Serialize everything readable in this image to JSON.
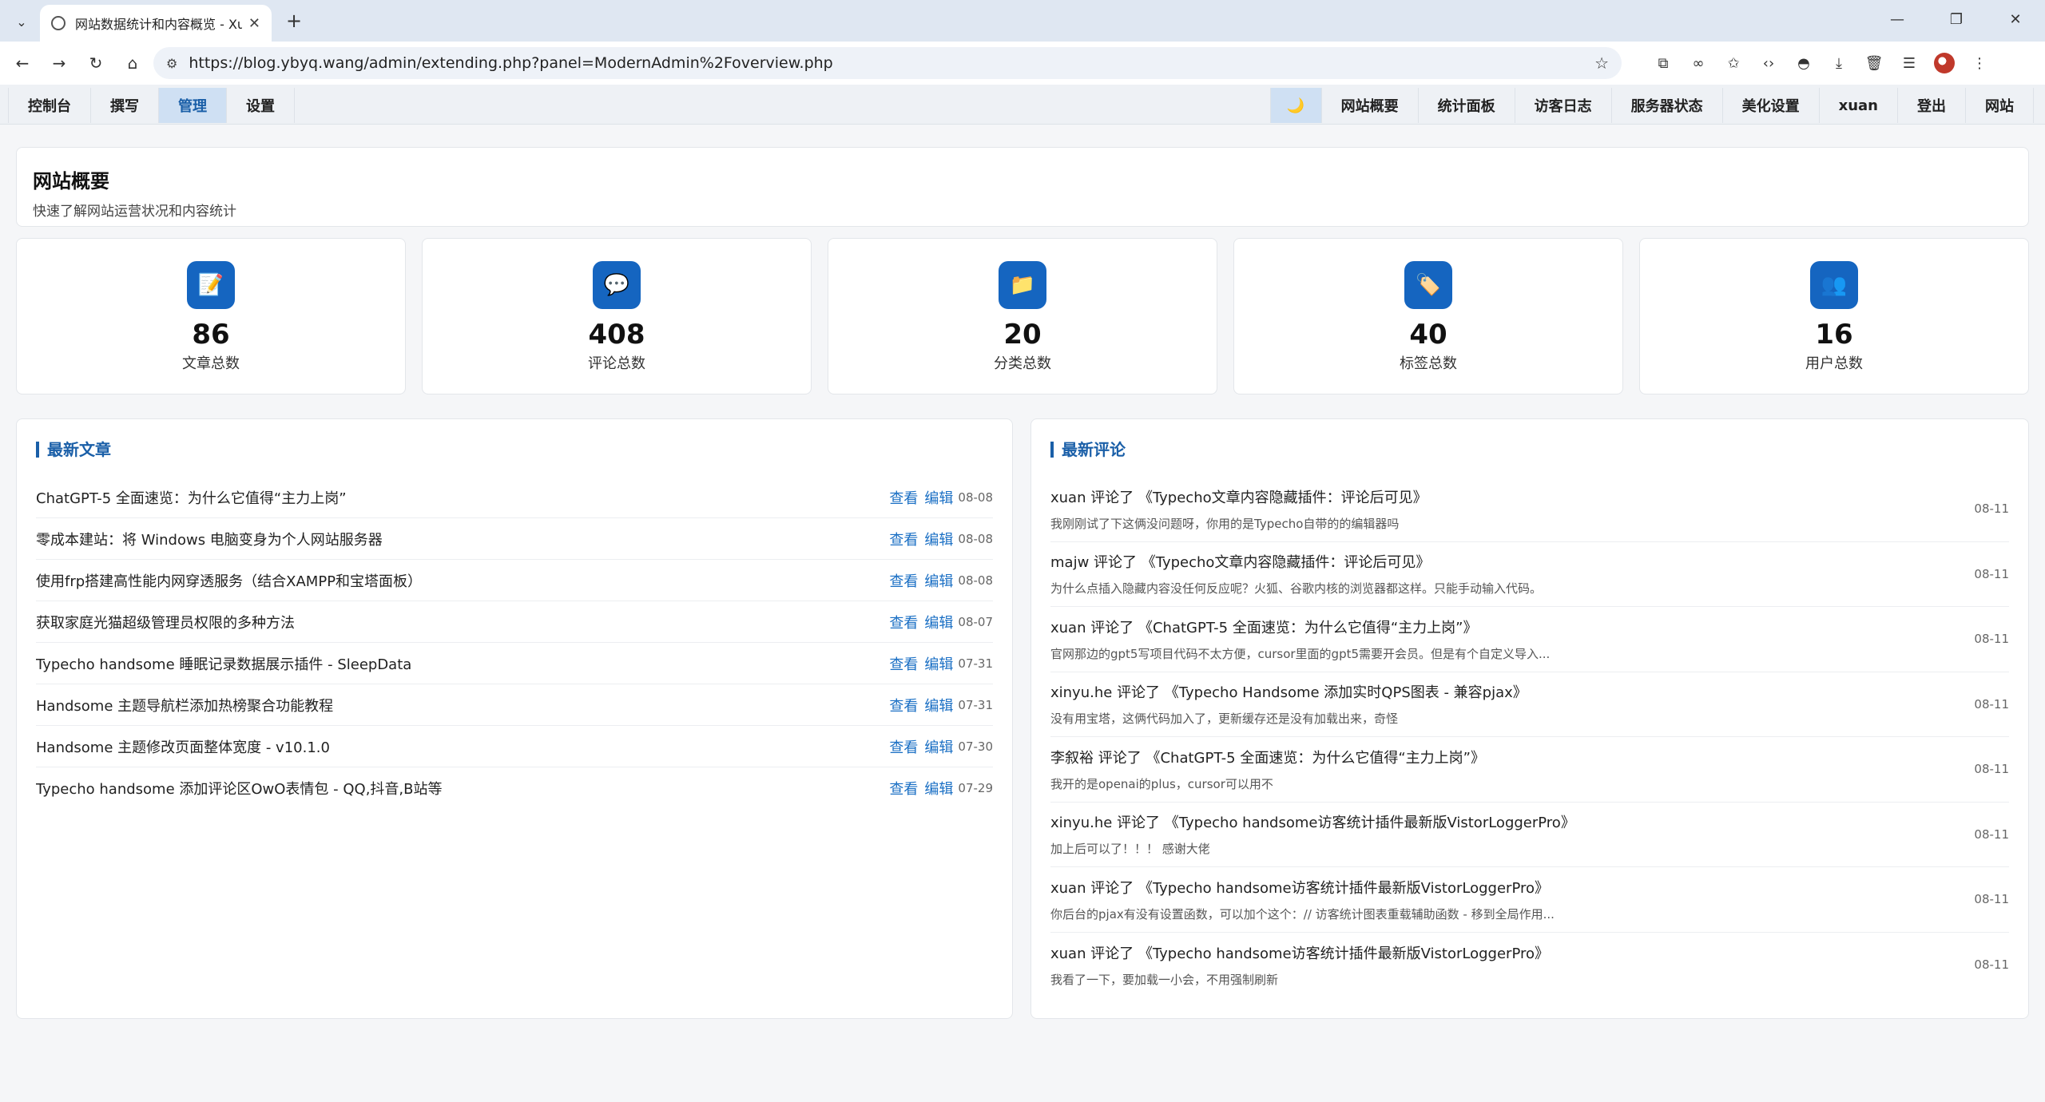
{
  "browser": {
    "tab_title": "网站数据统计和内容概览 - Xuan",
    "url": "https://blog.ybyq.wang/admin/extending.php?panel=ModernAdmin%2Foverview.php"
  },
  "nav": {
    "left": [
      "控制台",
      "撰写",
      "管理",
      "设置"
    ],
    "theme_icon": "🌙",
    "right": [
      "网站概要",
      "统计面板",
      "访客日志",
      "服务器状态",
      "美化设置",
      "xuan",
      "登出",
      "网站"
    ]
  },
  "header": {
    "title": "网站概要",
    "subtitle": "快速了解网站运营状况和内容统计"
  },
  "stats": [
    {
      "value": "86",
      "label": "文章总数",
      "icon": "📝"
    },
    {
      "value": "408",
      "label": "评论总数",
      "icon": "💬"
    },
    {
      "value": "20",
      "label": "分类总数",
      "icon": "📁"
    },
    {
      "value": "40",
      "label": "标签总数",
      "icon": "🏷️"
    },
    {
      "value": "16",
      "label": "用户总数",
      "icon": "👥"
    }
  ],
  "recent_posts": {
    "title": "最新文章",
    "view_label": "查看",
    "edit_label": "编辑",
    "items": [
      {
        "title": "ChatGPT-5 全面速览：为什么它值得“主力上岗”",
        "date": "08-08"
      },
      {
        "title": "零成本建站：将 Windows 电脑变身为个人网站服务器",
        "date": "08-08"
      },
      {
        "title": "使用frp搭建高性能内网穿透服务（结合XAMPP和宝塔面板）",
        "date": "08-08"
      },
      {
        "title": "获取家庭光猫超级管理员权限的多种方法",
        "date": "08-07"
      },
      {
        "title": "Typecho handsome 睡眠记录数据展示插件 - SleepData",
        "date": "07-31"
      },
      {
        "title": "Handsome 主题导航栏添加热榜聚合功能教程",
        "date": "07-31"
      },
      {
        "title": "Handsome 主题修改页面整体宽度 - v10.1.0",
        "date": "07-30"
      },
      {
        "title": "Typecho handsome 添加评论区OwO表情包 - QQ,抖音,B站等",
        "date": "07-29"
      }
    ]
  },
  "recent_comments": {
    "title": "最新评论",
    "items": [
      {
        "author": "xuan",
        "verb": "评论了",
        "post": "《Typecho文章内容隐藏插件：评论后可见》",
        "excerpt": "我刚刚试了下这俩没问题呀，你用的是Typecho自带的的编辑器吗",
        "date": "08-11"
      },
      {
        "author": "majw",
        "verb": "评论了",
        "post": "《Typecho文章内容隐藏插件：评论后可见》",
        "excerpt": "为什么点插入隐藏内容没任何反应呢？火狐、谷歌内核的浏览器都这样。只能手动输入代码。",
        "date": "08-11"
      },
      {
        "author": "xuan",
        "verb": "评论了",
        "post": "《ChatGPT-5 全面速览：为什么它值得“主力上岗”》",
        "excerpt": "官网那边的gpt5写项目代码不太方便，cursor里面的gpt5需要开会员。但是有个自定义导入...",
        "date": "08-11"
      },
      {
        "author": "xinyu.he",
        "verb": "评论了",
        "post": "《Typecho Handsome 添加实时QPS图表 - 兼容pjax》",
        "excerpt": "没有用宝塔，这俩代码加入了，更新缓存还是没有加载出来，奇怪",
        "date": "08-11"
      },
      {
        "author": "李叙裕",
        "verb": "评论了",
        "post": "《ChatGPT-5 全面速览：为什么它值得“主力上岗”》",
        "excerpt": "我开的是openai的plus，cursor可以用不",
        "date": "08-11"
      },
      {
        "author": "xinyu.he",
        "verb": "评论了",
        "post": "《Typecho handsome访客统计插件最新版VistorLoggerPro》",
        "excerpt": "加上后可以了！！！ 感谢大佬",
        "date": "08-11"
      },
      {
        "author": "xuan",
        "verb": "评论了",
        "post": "《Typecho handsome访客统计插件最新版VistorLoggerPro》",
        "excerpt": "你后台的pjax有没有设置函数，可以加个这个：// 访客统计图表重载辅助函数 - 移到全局作用...",
        "date": "08-11"
      },
      {
        "author": "xuan",
        "verb": "评论了",
        "post": "《Typecho handsome访客统计插件最新版VistorLoggerPro》",
        "excerpt": "我看了一下，要加载一小会，不用强制刷新",
        "date": "08-11"
      }
    ]
  },
  "colors": {
    "accent": "#1a5fa8",
    "stat_icon_bg": "#1565c0",
    "link": "#1a6fc4"
  }
}
